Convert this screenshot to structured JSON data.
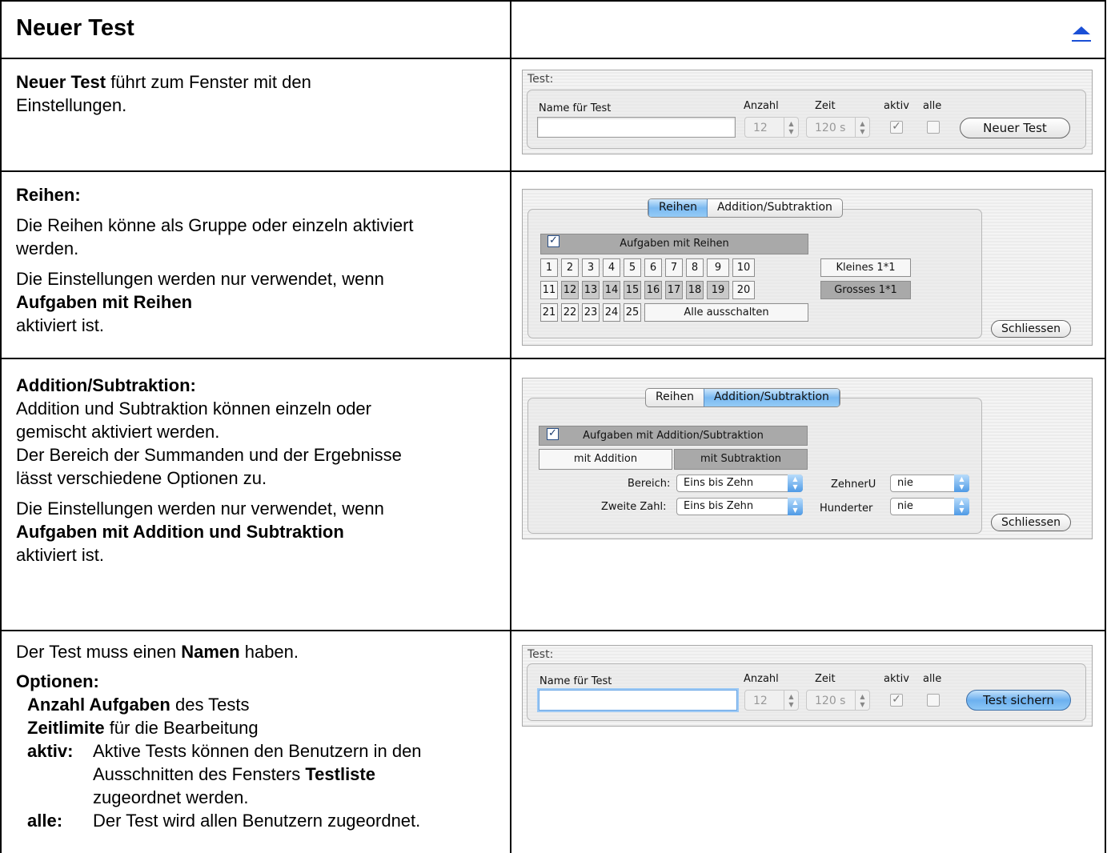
{
  "header": {
    "title": "Neuer Test"
  },
  "icons": {
    "back_to_top": "up-triangle-icon",
    "color": "#1a4fd6"
  },
  "sections": {
    "s1": {
      "bold_lead": "Neuer Test",
      "text_1": " führt zum Fenster mit den",
      "text_2": "Einstellungen."
    },
    "s2": {
      "heading": "Reihen:",
      "p1_line1": "Die Reihen könne als Gruppe oder einzeln aktiviert",
      "p1_line2": "werden.",
      "p2_line1": "Die Einstellungen werden nur verwendet, wenn",
      "p2_bold": "Aufgaben mit Reihen",
      "p2_line3": "aktiviert ist."
    },
    "s3": {
      "heading": "Addition/Subtraktion:",
      "p1_line1": "Addition und Subtraktion können einzeln oder",
      "p1_line2": "gemischt aktiviert werden.",
      "p1_line3": "Der Bereich der Summanden und der Ergebnisse",
      "p1_line4": "lässt verschiedene Optionen zu.",
      "p2_line1": "Die Einstellungen werden nur verwendet, wenn",
      "p2_bold": "Aufgaben mit Addition und Subtraktion",
      "p2_line3": "aktiviert ist."
    },
    "s4": {
      "line1_pre": "Der Test muss einen ",
      "line1_bold": "Namen",
      "line1_post": " haben.",
      "options_heading": "Optionen:",
      "opt1_bold": "Anzahl Aufgaben",
      "opt1_text": " des Tests",
      "opt2_bold": "Zeitlimite",
      "opt2_text": " für die Bearbeitung",
      "opt3_key": "aktiv:",
      "opt3_line1": "Aktive Tests können den Benutzern in den",
      "opt3_line2_pre": "Ausschnitten des Fensters ",
      "opt3_line2_bold": "Testliste",
      "opt3_line3": "zugeordnet werden.",
      "opt4_key": "alle:",
      "opt4_text": "Der Test wird allen Benutzern zugeordnet."
    }
  },
  "panel_test_a": {
    "group_label": "Test:",
    "name_label": "Name für Test",
    "name_value": "",
    "count_label": "Anzahl",
    "count_value": "12",
    "time_label": "Zeit",
    "time_value": "120 s",
    "active_label": "aktiv",
    "all_label": "alle",
    "button": "Neuer Test"
  },
  "panel_reihen": {
    "tabs": [
      "Reihen",
      "Addition/Subtraktion"
    ],
    "header_checkbox": "Aufgaben mit Reihen",
    "numbers": [
      "1",
      "2",
      "3",
      "4",
      "5",
      "6",
      "7",
      "8",
      "9",
      "10",
      "11",
      "12",
      "13",
      "14",
      "15",
      "16",
      "17",
      "18",
      "19",
      "20",
      "21",
      "22",
      "23",
      "24",
      "25"
    ],
    "all_off": "Alle ausschalten",
    "small_button": "Kleines 1*1",
    "big_button": "Grosses 1*1",
    "close": "Schliessen"
  },
  "panel_addsub": {
    "tabs": [
      "Reihen",
      "Addition/Subtraktion"
    ],
    "header_checkbox": "Aufgaben mit Addition/Subtraktion",
    "mit_addition": "mit Addition",
    "mit_subtraktion": "mit Subtraktion",
    "bereich_label": "Bereich:",
    "bereich_value": "Eins bis Zehn",
    "zweite_label": "Zweite Zahl:",
    "zweite_value": "Eins bis Zehn",
    "zehner_label": "ZehnerU",
    "zehner_value": "nie",
    "hunderter_label": "Hunderter",
    "hunderter_value": "nie",
    "close": "Schliessen"
  },
  "panel_test_b": {
    "group_label": "Test:",
    "name_label": "Name für Test",
    "name_value": "",
    "count_label": "Anzahl",
    "count_value": "12",
    "time_label": "Zeit",
    "time_value": "120 s",
    "active_label": "aktiv",
    "all_label": "alle",
    "button": "Test sichern"
  }
}
